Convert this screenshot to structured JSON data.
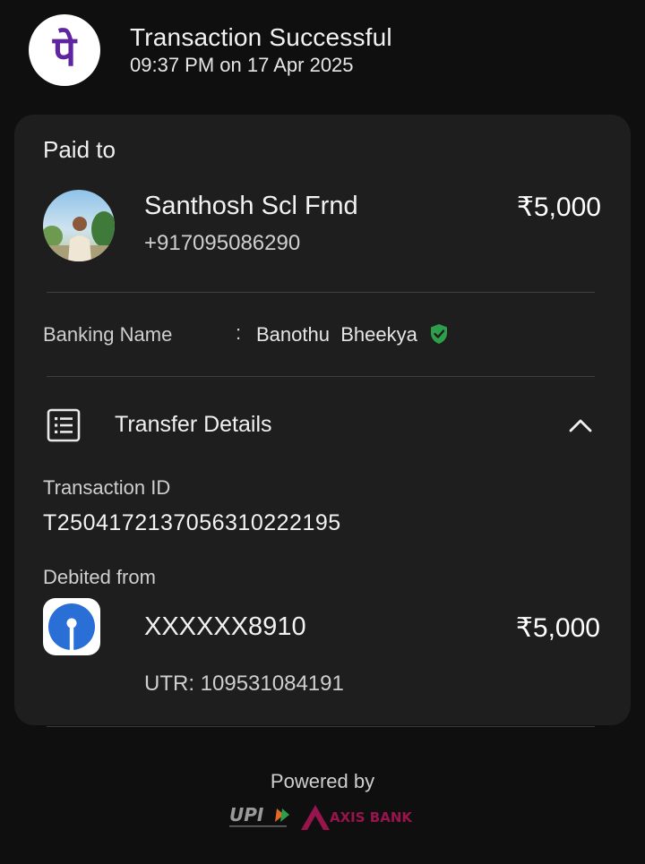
{
  "header": {
    "logo_icon": "phonepe-logo-icon",
    "title": "Transaction Successful",
    "datetime": "09:37 PM on 17 Apr 2025"
  },
  "paid_to": {
    "label": "Paid to",
    "name": "Santhosh Scl Frnd",
    "phone": "+917095086290",
    "amount": "₹5,000"
  },
  "banking": {
    "label": "Banking Name",
    "separator": ":",
    "name": "Banothu  Bheekya",
    "verified_icon": "verified-shield-icon",
    "verified_color": "#2e9e4a"
  },
  "transfer": {
    "title": "Transfer Details",
    "transaction_id_label": "Transaction ID",
    "transaction_id": "T2504172137056310222195",
    "debited_label": "Debited from",
    "account": "XXXXXX8910",
    "amount": "₹5,000",
    "utr": "UTR: 109531084191",
    "bank_icon": "sbi-logo-icon",
    "collapse_icon": "chevron-up-icon"
  },
  "footer": {
    "powered_by": "Powered by",
    "upi_logo": "UPI",
    "partner_bank": "AXIS BANK"
  },
  "colors": {
    "background": "#0f0f0f",
    "card": "#1e1e1e",
    "phonepe_purple": "#5f259f",
    "sbi_blue": "#2a6fd6",
    "axis_burgundy": "#97144d"
  }
}
